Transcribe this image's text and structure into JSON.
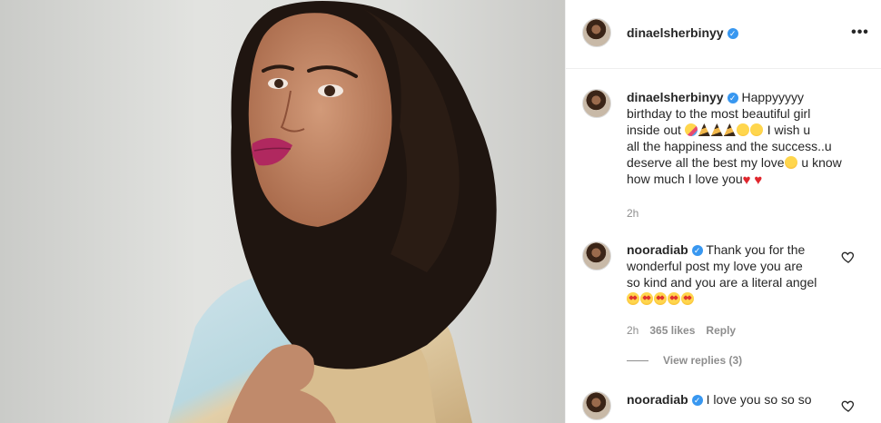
{
  "post": {
    "author": "dinaelsherbinyy",
    "verified": true,
    "more_icon": "more-horizontal-icon"
  },
  "caption": {
    "username": "dinaelsherbinyy",
    "line1": "Happyyyyy",
    "line2": "birthday to the most beautiful girl",
    "line3": "inside out",
    "line4": "I wish u",
    "line5": "all the happiness and the success..u",
    "line6": "deserve all the best my love",
    "line6b": "u know",
    "line7": "how much I love you",
    "time": "2h"
  },
  "comments": [
    {
      "username": "nooradiab",
      "line1": "Thank you for the",
      "line2": "wonderful post my love you are",
      "line3": "so kind and you are a literal angel",
      "time": "2h",
      "likes": "365 likes",
      "reply": "Reply",
      "view_replies": "View replies (3)"
    },
    {
      "username": "nooradiab",
      "line1": "I love you so so so"
    }
  ],
  "colors": {
    "verified": "#3897f0",
    "meta_text": "#8e8e8e",
    "heart_red": "#e0262d"
  }
}
